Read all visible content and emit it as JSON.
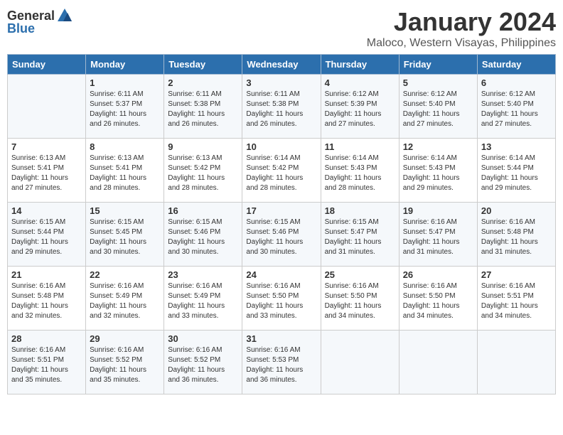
{
  "logo": {
    "general": "General",
    "blue": "Blue"
  },
  "title": "January 2024",
  "subtitle": "Maloco, Western Visayas, Philippines",
  "days_header": [
    "Sunday",
    "Monday",
    "Tuesday",
    "Wednesday",
    "Thursday",
    "Friday",
    "Saturday"
  ],
  "weeks": [
    [
      {
        "day": "",
        "sunrise": "",
        "sunset": "",
        "daylight": ""
      },
      {
        "day": "1",
        "sunrise": "Sunrise: 6:11 AM",
        "sunset": "Sunset: 5:37 PM",
        "daylight": "Daylight: 11 hours and 26 minutes."
      },
      {
        "day": "2",
        "sunrise": "Sunrise: 6:11 AM",
        "sunset": "Sunset: 5:38 PM",
        "daylight": "Daylight: 11 hours and 26 minutes."
      },
      {
        "day": "3",
        "sunrise": "Sunrise: 6:11 AM",
        "sunset": "Sunset: 5:38 PM",
        "daylight": "Daylight: 11 hours and 26 minutes."
      },
      {
        "day": "4",
        "sunrise": "Sunrise: 6:12 AM",
        "sunset": "Sunset: 5:39 PM",
        "daylight": "Daylight: 11 hours and 27 minutes."
      },
      {
        "day": "5",
        "sunrise": "Sunrise: 6:12 AM",
        "sunset": "Sunset: 5:40 PM",
        "daylight": "Daylight: 11 hours and 27 minutes."
      },
      {
        "day": "6",
        "sunrise": "Sunrise: 6:12 AM",
        "sunset": "Sunset: 5:40 PM",
        "daylight": "Daylight: 11 hours and 27 minutes."
      }
    ],
    [
      {
        "day": "7",
        "sunrise": "Sunrise: 6:13 AM",
        "sunset": "Sunset: 5:41 PM",
        "daylight": "Daylight: 11 hours and 27 minutes."
      },
      {
        "day": "8",
        "sunrise": "Sunrise: 6:13 AM",
        "sunset": "Sunset: 5:41 PM",
        "daylight": "Daylight: 11 hours and 28 minutes."
      },
      {
        "day": "9",
        "sunrise": "Sunrise: 6:13 AM",
        "sunset": "Sunset: 5:42 PM",
        "daylight": "Daylight: 11 hours and 28 minutes."
      },
      {
        "day": "10",
        "sunrise": "Sunrise: 6:14 AM",
        "sunset": "Sunset: 5:42 PM",
        "daylight": "Daylight: 11 hours and 28 minutes."
      },
      {
        "day": "11",
        "sunrise": "Sunrise: 6:14 AM",
        "sunset": "Sunset: 5:43 PM",
        "daylight": "Daylight: 11 hours and 28 minutes."
      },
      {
        "day": "12",
        "sunrise": "Sunrise: 6:14 AM",
        "sunset": "Sunset: 5:43 PM",
        "daylight": "Daylight: 11 hours and 29 minutes."
      },
      {
        "day": "13",
        "sunrise": "Sunrise: 6:14 AM",
        "sunset": "Sunset: 5:44 PM",
        "daylight": "Daylight: 11 hours and 29 minutes."
      }
    ],
    [
      {
        "day": "14",
        "sunrise": "Sunrise: 6:15 AM",
        "sunset": "Sunset: 5:44 PM",
        "daylight": "Daylight: 11 hours and 29 minutes."
      },
      {
        "day": "15",
        "sunrise": "Sunrise: 6:15 AM",
        "sunset": "Sunset: 5:45 PM",
        "daylight": "Daylight: 11 hours and 30 minutes."
      },
      {
        "day": "16",
        "sunrise": "Sunrise: 6:15 AM",
        "sunset": "Sunset: 5:46 PM",
        "daylight": "Daylight: 11 hours and 30 minutes."
      },
      {
        "day": "17",
        "sunrise": "Sunrise: 6:15 AM",
        "sunset": "Sunset: 5:46 PM",
        "daylight": "Daylight: 11 hours and 30 minutes."
      },
      {
        "day": "18",
        "sunrise": "Sunrise: 6:15 AM",
        "sunset": "Sunset: 5:47 PM",
        "daylight": "Daylight: 11 hours and 31 minutes."
      },
      {
        "day": "19",
        "sunrise": "Sunrise: 6:16 AM",
        "sunset": "Sunset: 5:47 PM",
        "daylight": "Daylight: 11 hours and 31 minutes."
      },
      {
        "day": "20",
        "sunrise": "Sunrise: 6:16 AM",
        "sunset": "Sunset: 5:48 PM",
        "daylight": "Daylight: 11 hours and 31 minutes."
      }
    ],
    [
      {
        "day": "21",
        "sunrise": "Sunrise: 6:16 AM",
        "sunset": "Sunset: 5:48 PM",
        "daylight": "Daylight: 11 hours and 32 minutes."
      },
      {
        "day": "22",
        "sunrise": "Sunrise: 6:16 AM",
        "sunset": "Sunset: 5:49 PM",
        "daylight": "Daylight: 11 hours and 32 minutes."
      },
      {
        "day": "23",
        "sunrise": "Sunrise: 6:16 AM",
        "sunset": "Sunset: 5:49 PM",
        "daylight": "Daylight: 11 hours and 33 minutes."
      },
      {
        "day": "24",
        "sunrise": "Sunrise: 6:16 AM",
        "sunset": "Sunset: 5:50 PM",
        "daylight": "Daylight: 11 hours and 33 minutes."
      },
      {
        "day": "25",
        "sunrise": "Sunrise: 6:16 AM",
        "sunset": "Sunset: 5:50 PM",
        "daylight": "Daylight: 11 hours and 34 minutes."
      },
      {
        "day": "26",
        "sunrise": "Sunrise: 6:16 AM",
        "sunset": "Sunset: 5:50 PM",
        "daylight": "Daylight: 11 hours and 34 minutes."
      },
      {
        "day": "27",
        "sunrise": "Sunrise: 6:16 AM",
        "sunset": "Sunset: 5:51 PM",
        "daylight": "Daylight: 11 hours and 34 minutes."
      }
    ],
    [
      {
        "day": "28",
        "sunrise": "Sunrise: 6:16 AM",
        "sunset": "Sunset: 5:51 PM",
        "daylight": "Daylight: 11 hours and 35 minutes."
      },
      {
        "day": "29",
        "sunrise": "Sunrise: 6:16 AM",
        "sunset": "Sunset: 5:52 PM",
        "daylight": "Daylight: 11 hours and 35 minutes."
      },
      {
        "day": "30",
        "sunrise": "Sunrise: 6:16 AM",
        "sunset": "Sunset: 5:52 PM",
        "daylight": "Daylight: 11 hours and 36 minutes."
      },
      {
        "day": "31",
        "sunrise": "Sunrise: 6:16 AM",
        "sunset": "Sunset: 5:53 PM",
        "daylight": "Daylight: 11 hours and 36 minutes."
      },
      {
        "day": "",
        "sunrise": "",
        "sunset": "",
        "daylight": ""
      },
      {
        "day": "",
        "sunrise": "",
        "sunset": "",
        "daylight": ""
      },
      {
        "day": "",
        "sunrise": "",
        "sunset": "",
        "daylight": ""
      }
    ]
  ]
}
